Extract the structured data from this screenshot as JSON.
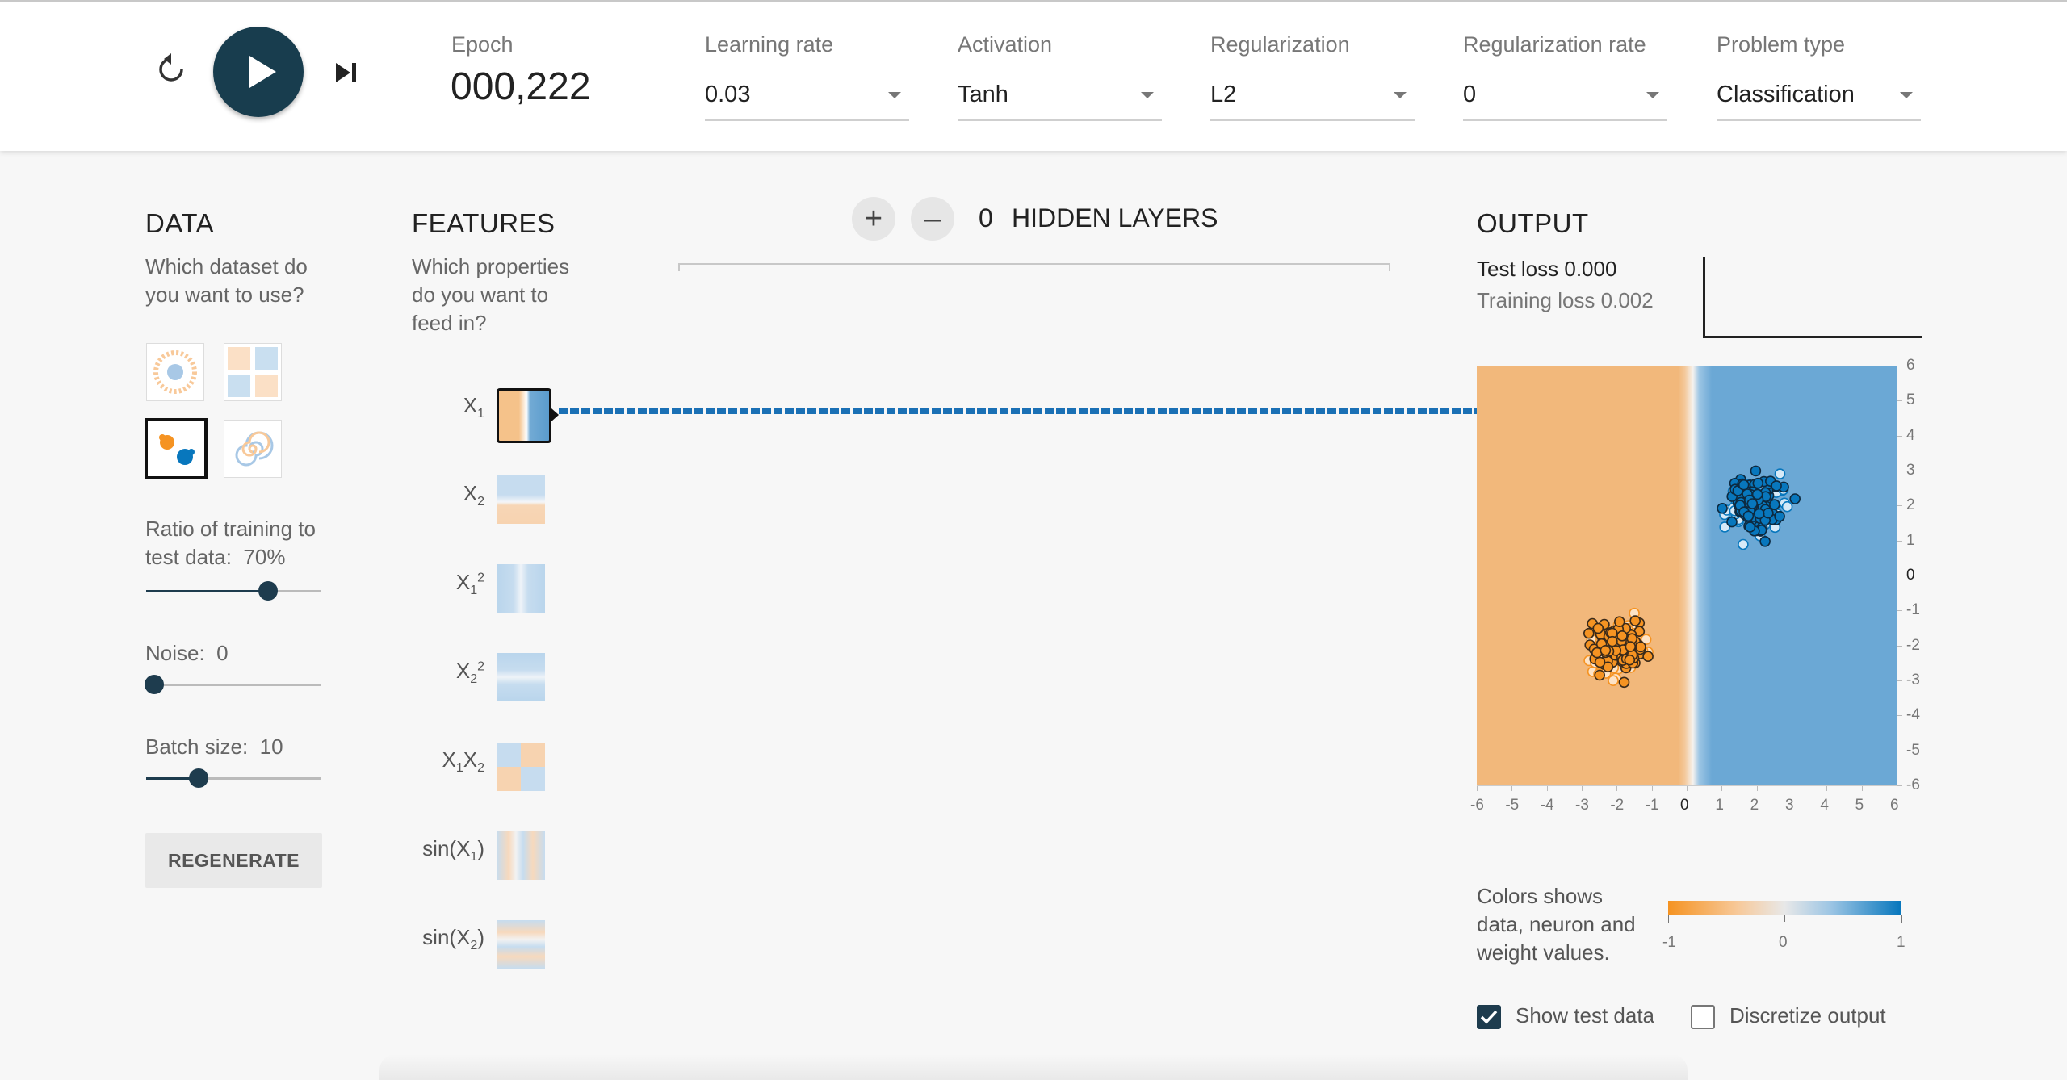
{
  "toolbar": {
    "reset_icon": "reset-icon",
    "play_icon": "play-icon",
    "step_icon": "step-forward-icon"
  },
  "epoch": {
    "label": "Epoch",
    "value": "000,222"
  },
  "controls": {
    "learning_rate": {
      "label": "Learning rate",
      "value": "0.03"
    },
    "activation": {
      "label": "Activation",
      "value": "Tanh"
    },
    "regularization": {
      "label": "Regularization",
      "value": "L2"
    },
    "regularization_rate": {
      "label": "Regularization rate",
      "value": "0"
    },
    "problem_type": {
      "label": "Problem type",
      "value": "Classification"
    }
  },
  "data": {
    "heading": "DATA",
    "description": "Which dataset do you want to use?",
    "ratio_label": "Ratio of training to test data:",
    "ratio_value": "70%",
    "ratio": 0.7,
    "noise_label": "Noise:",
    "noise_value": "0",
    "noise": 0,
    "batch_label": "Batch size:",
    "batch_value": "10",
    "batch": 0.3,
    "regenerate": "REGENERATE"
  },
  "features": {
    "heading": "FEATURES",
    "description": "Which properties do you want to feed in?"
  },
  "hidden": {
    "add": "+",
    "remove": "–",
    "count": "0",
    "label": "HIDDEN LAYERS"
  },
  "output": {
    "heading": "OUTPUT",
    "test_loss": "Test loss 0.000",
    "training_loss": "Training loss 0.002",
    "y_ticks": [
      "6",
      "5",
      "4",
      "3",
      "2",
      "1",
      "0",
      "-1",
      "-2",
      "-3",
      "-4",
      "-5",
      "-6"
    ],
    "x_ticks": [
      "-6",
      "-5",
      "-4",
      "-3",
      "-2",
      "-1",
      "0",
      "1",
      "2",
      "3",
      "4",
      "5",
      "6"
    ],
    "colors_text": "Colors shows data, neuron and weight values.",
    "scale_min": "-1",
    "scale_mid": "0",
    "scale_max": "1",
    "show_test": "Show test data",
    "discretize": "Discretize output",
    "show_test_checked": true,
    "discretize_checked": false
  },
  "colors": {
    "orange": "#f59322",
    "blue": "#0877bd",
    "dark": "#1e3c4e"
  }
}
